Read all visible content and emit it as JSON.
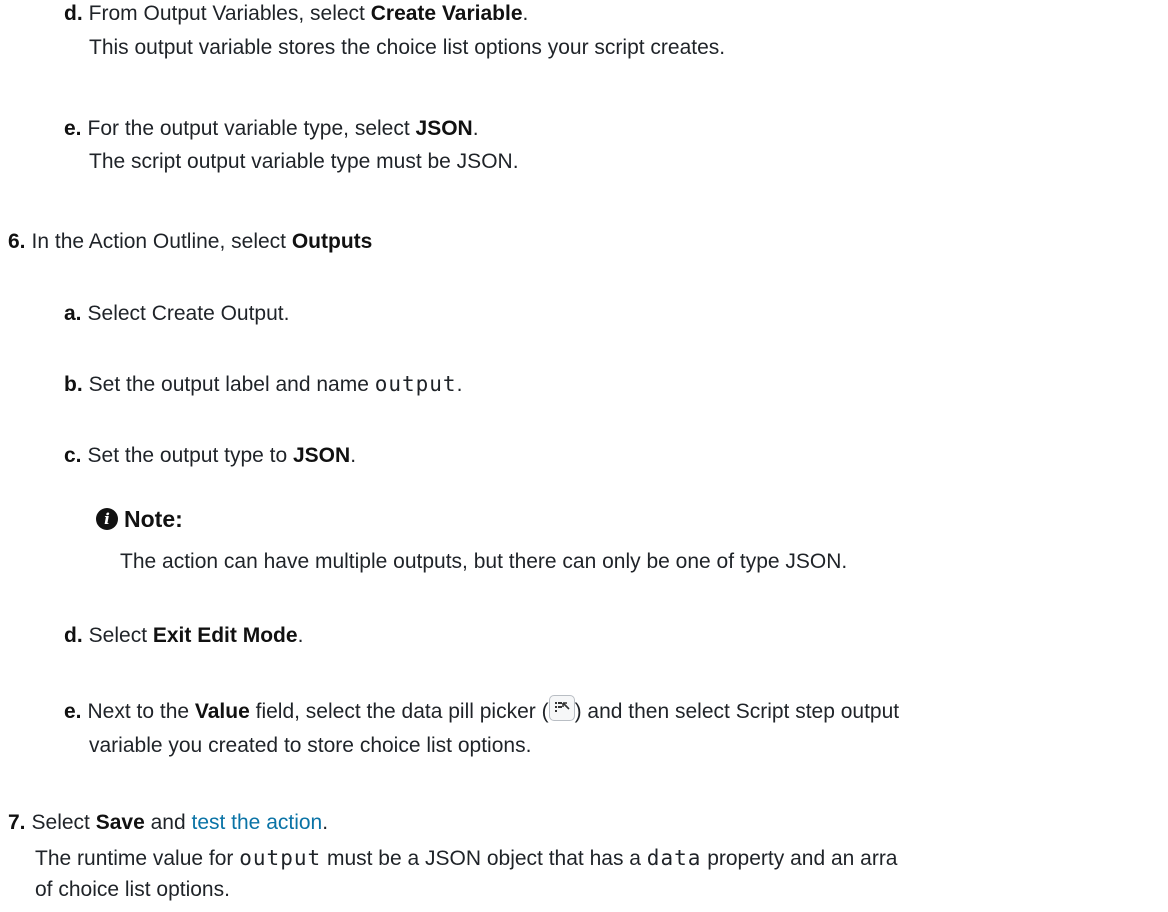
{
  "step5": {
    "d": {
      "marker": "d.",
      "text_before": "From Output Variables, select ",
      "bold": "Create Variable",
      "text_after": ".",
      "description": "This output variable stores the choice list options your script creates."
    },
    "e": {
      "marker": "e.",
      "text_before": "For the output variable type, select ",
      "bold": "JSON",
      "text_after": ".",
      "description": "The script output variable type must be JSON."
    }
  },
  "step6": {
    "marker": "6.",
    "text_before": "In the Action Outline, select ",
    "bold": "Outputs",
    "a": {
      "marker": "a.",
      "text": "Select Create Output."
    },
    "b": {
      "marker": "b.",
      "text_before": "Set the output label and name ",
      "code": "output",
      "text_after": "."
    },
    "c": {
      "marker": "c.",
      "text_before": "Set the output type to ",
      "bold": "JSON",
      "text_after": "."
    },
    "note": {
      "icon": "info-icon",
      "title": "Note:",
      "text": "The action can have multiple outputs, but there can only be one of type JSON."
    },
    "d": {
      "marker": "d.",
      "text_before": "Select ",
      "bold": "Exit Edit Mode",
      "text_after": "."
    },
    "e": {
      "marker": "e.",
      "text_before": "Next to the ",
      "bold": "Value",
      "text_middle": " field, select the data pill picker (",
      "icon": "data-pill-picker-icon",
      "text_after": ") and then select Script step output",
      "line2": "variable you created to store choice list options."
    }
  },
  "step7": {
    "marker": "7.",
    "text_before": "Select ",
    "bold": "Save",
    "text_middle": " and ",
    "link": "test the action",
    "text_after": ".",
    "desc_before": "The runtime value for ",
    "desc_code1": "output",
    "desc_middle": " must be a JSON object that has a ",
    "desc_code2": "data",
    "desc_after": " property and an arra",
    "desc_line2": "of choice list options."
  },
  "colors": {
    "text": "#1f2328",
    "link": "#0a73a6"
  }
}
